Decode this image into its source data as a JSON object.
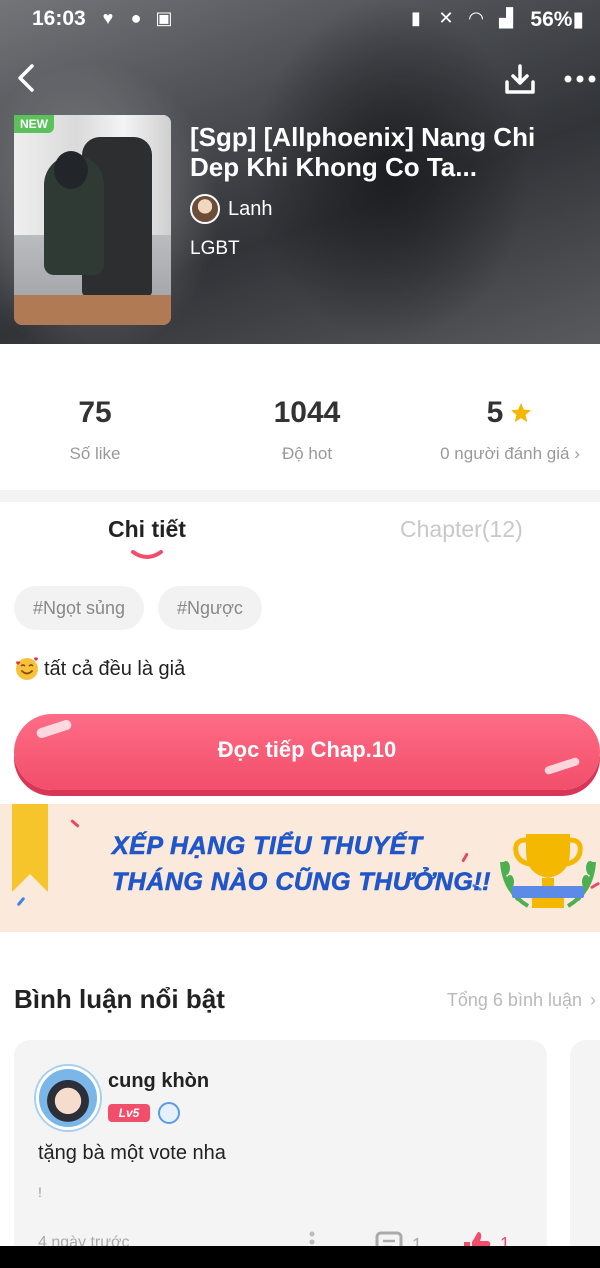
{
  "status_bar": {
    "time": "16:03",
    "battery": "56%"
  },
  "book": {
    "badge": "NEW",
    "title": "[Sgp] [Allphoenix] Nang Chi Dep Khi Khong Co Ta...",
    "author": "Lanh",
    "genre": "LGBT"
  },
  "stats": [
    {
      "value": "75",
      "label": "Số like"
    },
    {
      "value": "1044",
      "label": "Độ hot"
    },
    {
      "value": "5",
      "label": "0 người đánh giá"
    }
  ],
  "tabs": {
    "detail": "Chi tiết",
    "chapter": "Chapter(12)"
  },
  "tags": [
    "#Ngọt sủng",
    "#Ngược"
  ],
  "description": "tất cả đều là giả",
  "read_button": "Đọc tiếp Chap.10",
  "banner": {
    "line1": "XẾP HẠNG TIỂU THUYẾT",
    "line2": "THÁNG NÀO CŨNG THƯỞNG!!"
  },
  "comments_section": {
    "title": "Bình luận nổi bật",
    "total": "Tổng 6 bình luận",
    "comment": {
      "user": "cung khòn",
      "level": "Lv5",
      "text": "tặng bà một vote nha",
      "subtext": "!",
      "time": "4 ngày trước",
      "replies": "1",
      "likes": "1"
    }
  },
  "colors": {
    "accent": "#f04e6a",
    "star": "#f5b800",
    "banner_text": "#1f56c9"
  }
}
